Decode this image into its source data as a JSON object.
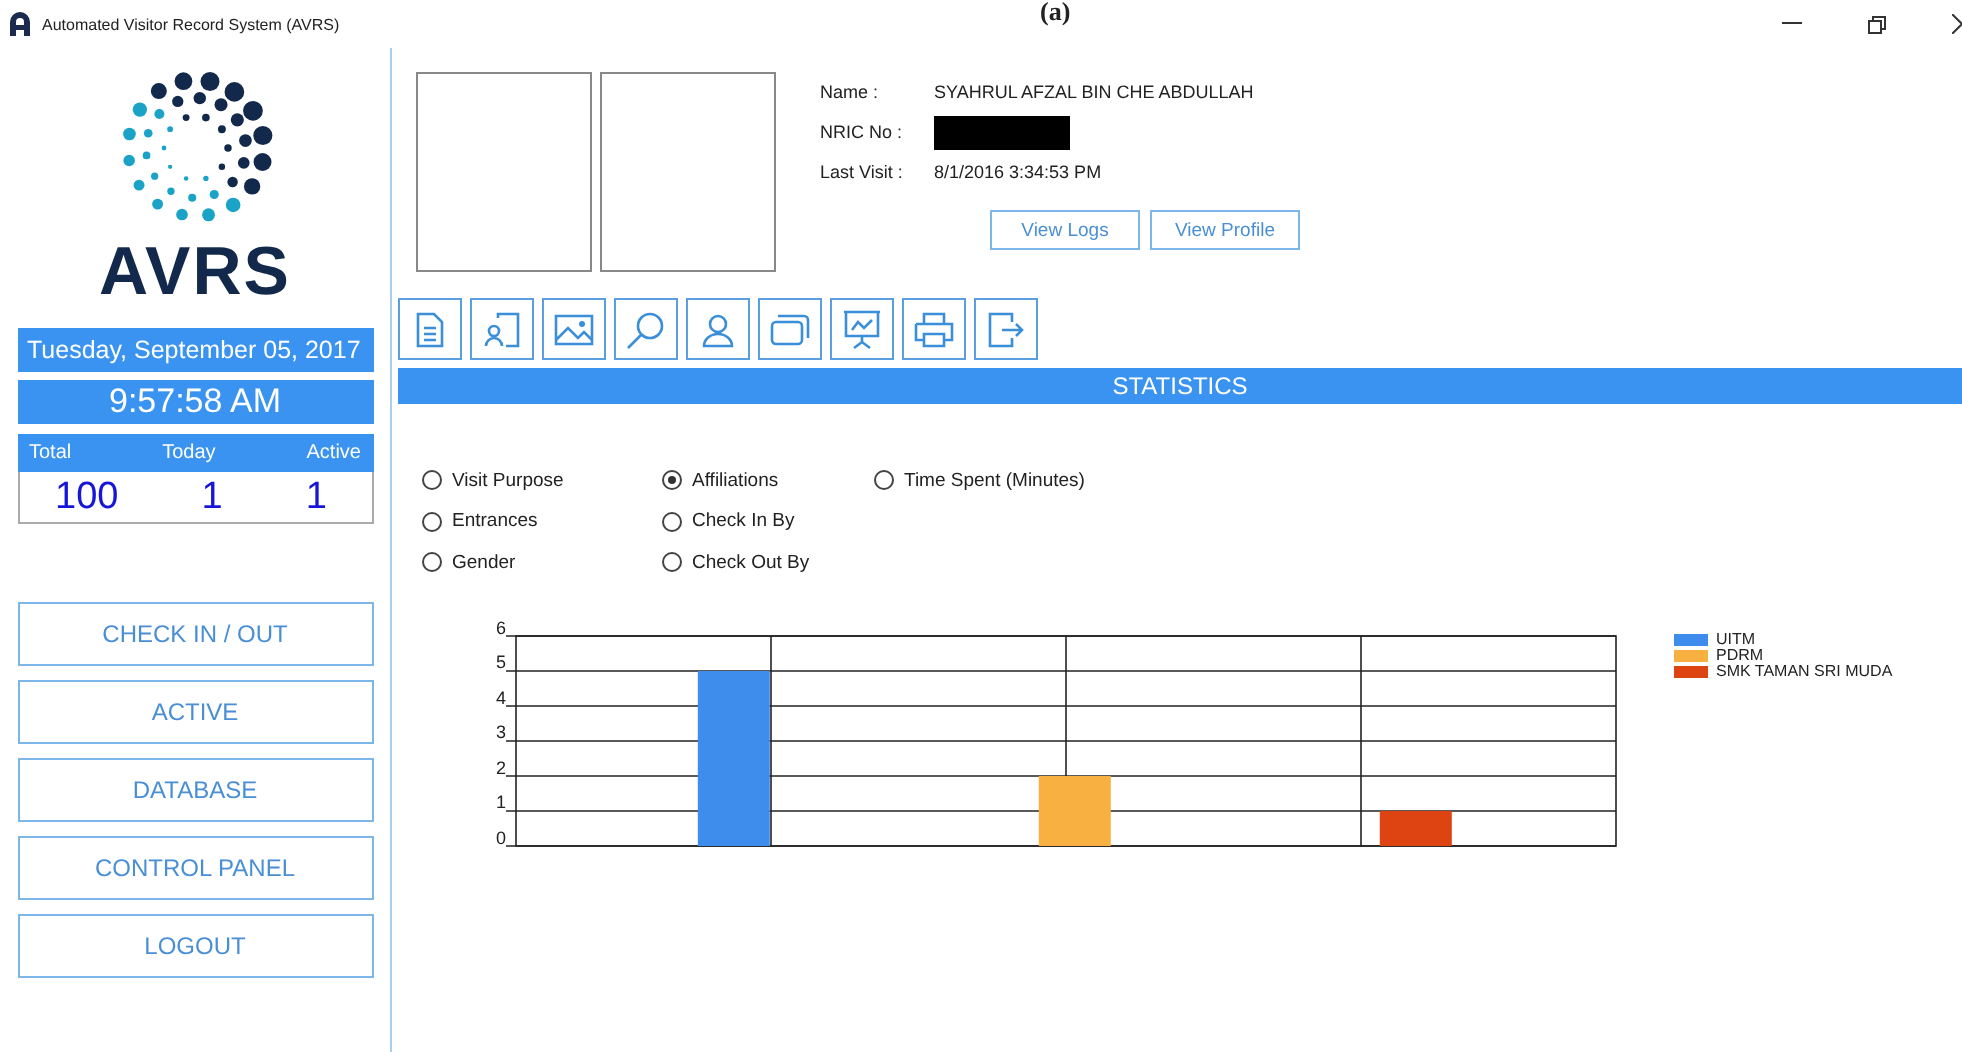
{
  "caption": "(a)",
  "window": {
    "title": "Automated Visitor Record System (AVRS)"
  },
  "sidebar": {
    "logo_text": "AVRS",
    "date": "Tuesday, September 05, 2017",
    "time": "9:57:58 AM",
    "counters": [
      {
        "label": "Total",
        "value": "100"
      },
      {
        "label": "Today",
        "value": "1"
      },
      {
        "label": "Active",
        "value": "1"
      }
    ],
    "buttons": [
      "CHECK IN / OUT",
      "ACTIVE",
      "DATABASE",
      "CONTROL PANEL",
      "LOGOUT"
    ]
  },
  "visitor": {
    "fields": [
      {
        "label": "Name :",
        "value": "SYAHRUL AFZAL BIN CHE ABDULLAH",
        "kind": "text"
      },
      {
        "label": "NRIC No :",
        "kind": "redacted"
      },
      {
        "label": "Last Visit :",
        "value": "8/1/2016 3:34:53 PM",
        "kind": "text"
      }
    ],
    "buttons": [
      "View Logs",
      "View Profile"
    ]
  },
  "statistics": {
    "title": "STATISTICS",
    "options": [
      [
        {
          "label": "Visit Purpose",
          "selected": false
        },
        {
          "label": "Entrances",
          "selected": false
        },
        {
          "label": "Gender",
          "selected": false
        }
      ],
      [
        {
          "label": "Affiliations",
          "selected": true
        },
        {
          "label": "Check In By",
          "selected": false
        },
        {
          "label": "Check Out By",
          "selected": false
        }
      ],
      [
        {
          "label": "Time Spent (Minutes)",
          "selected": false
        }
      ]
    ],
    "chart_data": {
      "type": "bar",
      "grid": true,
      "legend": true,
      "ylim": [
        0,
        6
      ],
      "yticks": [
        0,
        1,
        2,
        3,
        4,
        5,
        6
      ],
      "series": [
        {
          "name": "UITM",
          "color": "#3e8ded",
          "values": [
            5,
            null,
            null
          ]
        },
        {
          "name": "PDRM",
          "color": "#f8b140",
          "values": [
            null,
            2,
            null
          ]
        },
        {
          "name": "SMK TAMAN SRI MUDA",
          "color": "#dd4412",
          "values": [
            null,
            null,
            1
          ]
        }
      ]
    }
  }
}
